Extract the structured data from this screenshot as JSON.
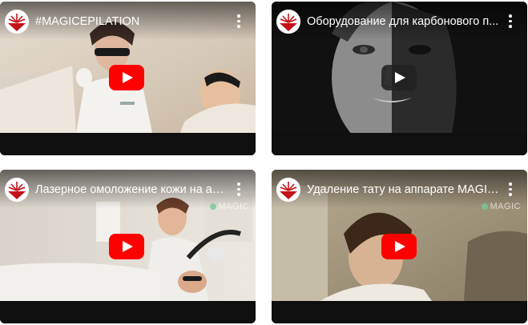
{
  "videos": [
    {
      "title": "#MAGICEPILATION",
      "watermark": ""
    },
    {
      "title": "Оборудование для карбонового п...",
      "watermark": ""
    },
    {
      "title": "Лазерное омоложение кожи на апп...",
      "watermark": "MAGIC"
    },
    {
      "title": "Удаление тату на аппарате MAGIC...",
      "watermark": "MAGIC"
    }
  ],
  "icons": {
    "play": "youtube-play-icon",
    "more": "more-vert-icon",
    "channel": "magic-logo-icon"
  },
  "colors": {
    "play_red": "#ff0000",
    "logo_red": "#c4121a",
    "bar": "#0f0f0f"
  }
}
